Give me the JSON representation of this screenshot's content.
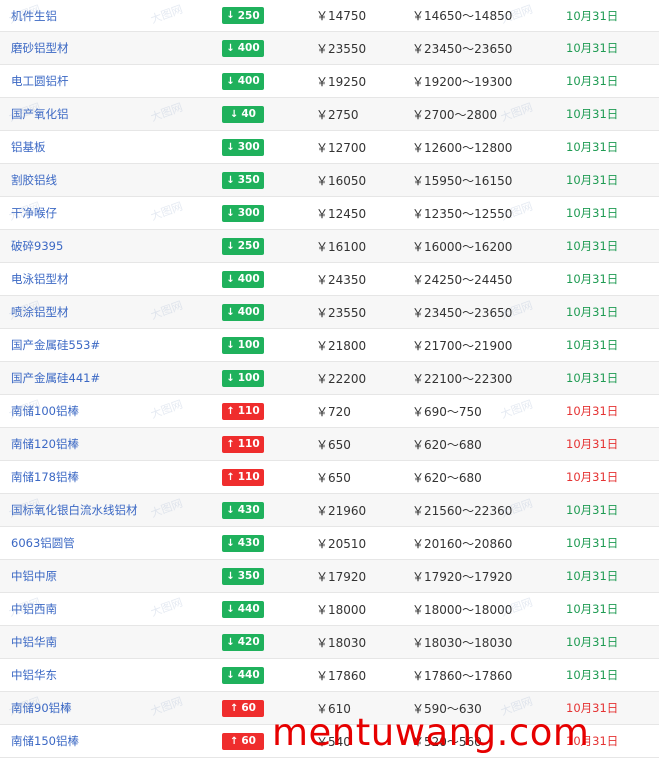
{
  "rows": [
    {
      "name": "机件生铝",
      "dir": "down",
      "change": "250",
      "price": "￥14750",
      "range": "￥14650～14850",
      "date": "10月31日"
    },
    {
      "name": "磨砂铝型材",
      "dir": "down",
      "change": "400",
      "price": "￥23550",
      "range": "￥23450～23650",
      "date": "10月31日"
    },
    {
      "name": "电工圆铝杆",
      "dir": "down",
      "change": "400",
      "price": "￥19250",
      "range": "￥19200～19300",
      "date": "10月31日"
    },
    {
      "name": "国产氧化铝",
      "dir": "down",
      "change": "40",
      "price": "￥2750",
      "range": "￥2700～2800",
      "date": "10月31日"
    },
    {
      "name": "铝基板",
      "dir": "down",
      "change": "300",
      "price": "￥12700",
      "range": "￥12600～12800",
      "date": "10月31日"
    },
    {
      "name": "割胶铝线",
      "dir": "down",
      "change": "350",
      "price": "￥16050",
      "range": "￥15950～16150",
      "date": "10月31日"
    },
    {
      "name": "干净喉仔",
      "dir": "down",
      "change": "300",
      "price": "￥12450",
      "range": "￥12350～12550",
      "date": "10月31日"
    },
    {
      "name": "破碎9395",
      "dir": "down",
      "change": "250",
      "price": "￥16100",
      "range": "￥16000～16200",
      "date": "10月31日"
    },
    {
      "name": "电泳铝型材",
      "dir": "down",
      "change": "400",
      "price": "￥24350",
      "range": "￥24250～24450",
      "date": "10月31日"
    },
    {
      "name": "喷涂铝型材",
      "dir": "down",
      "change": "400",
      "price": "￥23550",
      "range": "￥23450～23650",
      "date": "10月31日"
    },
    {
      "name": "国产金属硅553#",
      "dir": "down",
      "change": "100",
      "price": "￥21800",
      "range": "￥21700～21900",
      "date": "10月31日"
    },
    {
      "name": "国产金属硅441#",
      "dir": "down",
      "change": "100",
      "price": "￥22200",
      "range": "￥22100～22300",
      "date": "10月31日"
    },
    {
      "name": "南储100铝棒",
      "dir": "up",
      "change": "110",
      "price": "￥720",
      "range": "￥690～750",
      "date": "10月31日"
    },
    {
      "name": "南储120铝棒",
      "dir": "up",
      "change": "110",
      "price": "￥650",
      "range": "￥620～680",
      "date": "10月31日"
    },
    {
      "name": "南储178铝棒",
      "dir": "up",
      "change": "110",
      "price": "￥650",
      "range": "￥620～680",
      "date": "10月31日"
    },
    {
      "name": "国标氧化银白流水线铝材",
      "dir": "down",
      "change": "430",
      "price": "￥21960",
      "range": "￥21560～22360",
      "date": "10月31日"
    },
    {
      "name": "6063铝圆管",
      "dir": "down",
      "change": "430",
      "price": "￥20510",
      "range": "￥20160～20860",
      "date": "10月31日"
    },
    {
      "name": "中铝中原",
      "dir": "down",
      "change": "350",
      "price": "￥17920",
      "range": "￥17920～17920",
      "date": "10月31日"
    },
    {
      "name": "中铝西南",
      "dir": "down",
      "change": "440",
      "price": "￥18000",
      "range": "￥18000～18000",
      "date": "10月31日"
    },
    {
      "name": "中铝华南",
      "dir": "down",
      "change": "420",
      "price": "￥18030",
      "range": "￥18030～18030",
      "date": "10月31日"
    },
    {
      "name": "中铝华东",
      "dir": "down",
      "change": "440",
      "price": "￥17860",
      "range": "￥17860～17860",
      "date": "10月31日"
    },
    {
      "name": "南储90铝棒",
      "dir": "up",
      "change": "60",
      "price": "￥610",
      "range": "￥590～630",
      "date": "10月31日"
    },
    {
      "name": "南储150铝棒",
      "dir": "up",
      "change": "60",
      "price": "￥540",
      "range": "￥520～560",
      "date": "10月31日"
    }
  ],
  "arrows": {
    "down": "↓",
    "up": "↑"
  },
  "colors": {
    "down": "#1fb15c",
    "up": "#ef2d2d",
    "link": "#3b68c4"
  },
  "watermark": "mentuwang.com",
  "faint_watermark": "大图网"
}
